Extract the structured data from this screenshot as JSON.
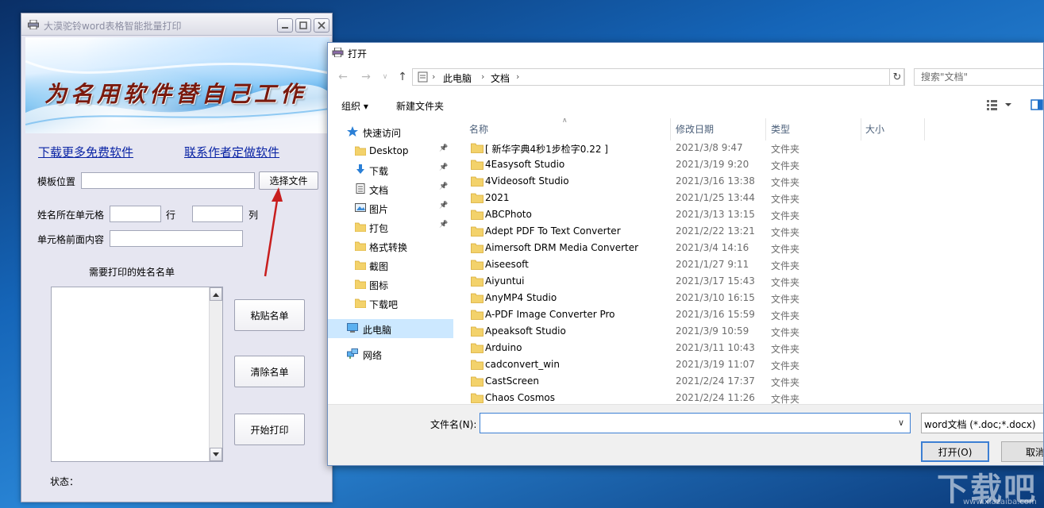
{
  "app": {
    "title": "大漠驼铃word表格智能批量打印",
    "banner_text": "为名用软件替自己工作",
    "link_download": "下载更多免费软件",
    "link_contact": "联系作者定做软件",
    "template_label": "模板位置",
    "template_value": "",
    "select_file_label": "选择文件",
    "name_cell_label": "姓名所在单元格",
    "row_value": "",
    "row_label": "行",
    "col_value": "",
    "col_label": "列",
    "prefix_label": "单元格前面内容",
    "prefix_value": "",
    "list_title": "需要打印的姓名名单",
    "paste_label": "粘贴名单",
    "clear_label": "清除名单",
    "print_label": "开始打印",
    "status_label": "状态："
  },
  "dialog": {
    "title": "打开",
    "breadcrumbs": [
      "此电脑",
      "文档"
    ],
    "search_placeholder": "搜索\"文档\"",
    "toolbar": {
      "organize": "组织 ▾",
      "new_folder": "新建文件夹"
    },
    "nav_items": [
      {
        "label": "快速访问",
        "icon": "star-icon",
        "pinned": false,
        "indent": 1
      },
      {
        "label": "Desktop",
        "icon": "folder-icon",
        "pinned": true,
        "indent": 2
      },
      {
        "label": "下载",
        "icon": "download-icon",
        "pinned": true,
        "indent": 2
      },
      {
        "label": "文档",
        "icon": "document-icon",
        "pinned": true,
        "indent": 2
      },
      {
        "label": "图片",
        "icon": "picture-icon",
        "pinned": true,
        "indent": 2
      },
      {
        "label": "打包",
        "icon": "folder-icon",
        "pinned": true,
        "indent": 2
      },
      {
        "label": "格式转换",
        "icon": "folder-icon",
        "pinned": false,
        "indent": 2
      },
      {
        "label": "截图",
        "icon": "folder-icon",
        "pinned": false,
        "indent": 2
      },
      {
        "label": "图标",
        "icon": "folder-icon",
        "pinned": false,
        "indent": 2
      },
      {
        "label": "下载吧",
        "icon": "folder-icon",
        "pinned": false,
        "indent": 2
      },
      {
        "label": "此电脑",
        "icon": "computer-icon",
        "pinned": false,
        "indent": 1,
        "selected": true
      },
      {
        "label": "网络",
        "icon": "network-icon",
        "pinned": false,
        "indent": 1
      }
    ],
    "columns": {
      "name": "名称",
      "date": "修改日期",
      "type": "类型",
      "size": "大小"
    },
    "files": [
      {
        "name": "[ 新华字典4秒1步检字0.22 ]",
        "date": "2021/3/8 9:47",
        "type": "文件夹"
      },
      {
        "name": "4Easysoft Studio",
        "date": "2021/3/19 9:20",
        "type": "文件夹"
      },
      {
        "name": "4Videosoft Studio",
        "date": "2021/3/16 13:38",
        "type": "文件夹"
      },
      {
        "name": "2021",
        "date": "2021/1/25 13:44",
        "type": "文件夹"
      },
      {
        "name": "ABCPhoto",
        "date": "2021/3/13 13:15",
        "type": "文件夹"
      },
      {
        "name": "Adept PDF To Text Converter",
        "date": "2021/2/22 13:21",
        "type": "文件夹"
      },
      {
        "name": "Aimersoft DRM Media Converter",
        "date": "2021/3/4 14:16",
        "type": "文件夹"
      },
      {
        "name": "Aiseesoft",
        "date": "2021/1/27 9:11",
        "type": "文件夹"
      },
      {
        "name": "Aiyuntui",
        "date": "2021/3/17 15:43",
        "type": "文件夹"
      },
      {
        "name": "AnyMP4 Studio",
        "date": "2021/3/10 16:15",
        "type": "文件夹"
      },
      {
        "name": "A-PDF Image Converter Pro",
        "date": "2021/3/16 15:59",
        "type": "文件夹"
      },
      {
        "name": "Apeaksoft Studio",
        "date": "2021/3/9 10:59",
        "type": "文件夹"
      },
      {
        "name": "Arduino",
        "date": "2021/3/11 10:43",
        "type": "文件夹"
      },
      {
        "name": "cadconvert_win",
        "date": "2021/3/19 11:07",
        "type": "文件夹"
      },
      {
        "name": "CastScreen",
        "date": "2021/2/24 17:37",
        "type": "文件夹"
      },
      {
        "name": "Chaos Cosmos",
        "date": "2021/2/24 11:26",
        "type": "文件夹"
      }
    ],
    "filename_label": "文件名(N):",
    "filename_value": "",
    "filetype_value": "word文档 (*.doc;*.docx)",
    "open_label": "打开(O)",
    "cancel_label": "取消"
  },
  "watermark": {
    "main": "下载吧",
    "sub": "www.xiazaiba.com"
  },
  "colors": {
    "accent": "#3c7fd3",
    "link": "#0a24a5",
    "folder": "#f3d26b",
    "selection": "#cce8ff"
  }
}
